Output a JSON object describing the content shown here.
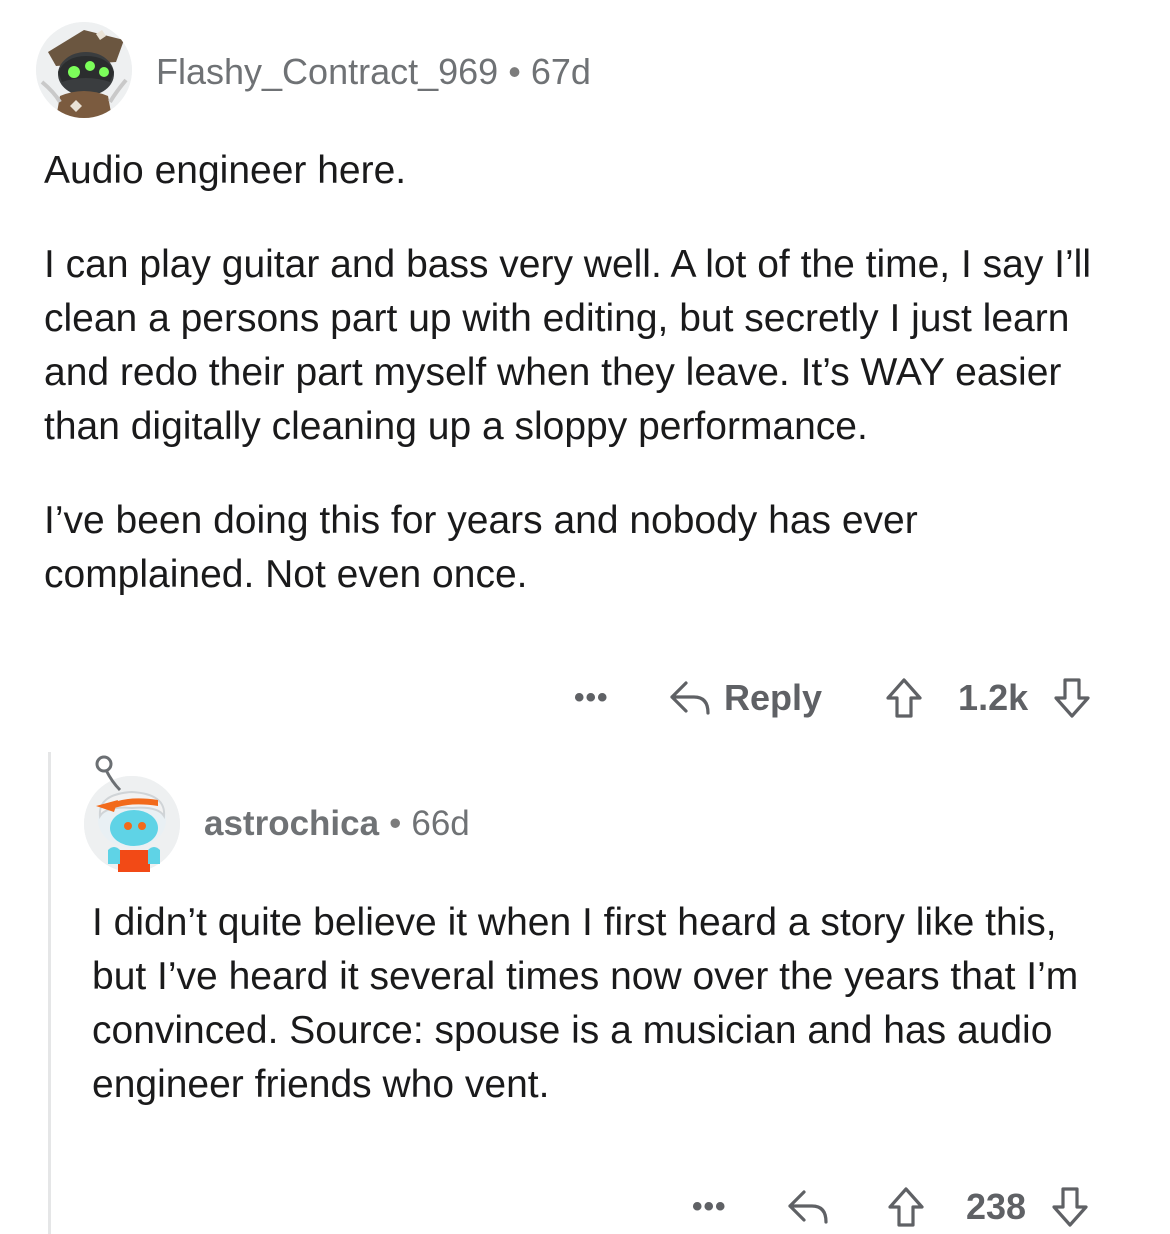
{
  "comments": [
    {
      "username": "Flashy_Contract_969",
      "separator": "•",
      "age": "67d",
      "paragraphs": [
        "Audio engineer here.",
        "I can play guitar and bass very well. A lot of the time, I say I’ll clean a persons part up with editing, but secretly I just learn and redo their part myself when they leave. It’s WAY easier than digitally cleaning up a sloppy performance.",
        "I’ve been doing this for years and nobody has ever complained. Not even once."
      ],
      "more_label": "•••",
      "reply_label": "Reply",
      "votes": "1.2k"
    },
    {
      "username": "astrochica",
      "separator": "•",
      "age": "66d",
      "paragraphs": [
        "I didn’t quite believe it when I first heard a story like this, but I’ve heard it several times now over the years that I’m convinced. Source: spouse is a musician and has audio engineer friends who vent."
      ],
      "more_label": "•••",
      "votes": "238"
    }
  ]
}
